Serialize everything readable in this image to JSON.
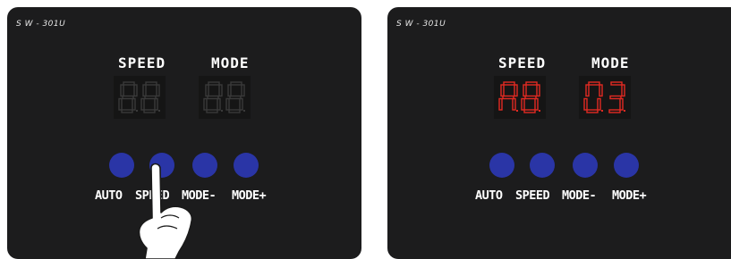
{
  "panel_left": {
    "model": "S W - 301U",
    "speed_label": "SPEED",
    "mode_label": "MODE",
    "speed_display": "88",
    "mode_display": "88",
    "display_color": "#3a3a3a",
    "buttons": [
      "AUTO",
      "SPEED",
      "MODE-",
      "MODE+"
    ],
    "pressed_button": "SPEED"
  },
  "panel_right": {
    "model": "S W - 301U",
    "speed_label": "SPEED",
    "mode_label": "MODE",
    "speed_display": "A8",
    "mode_display": "03",
    "display_color": "#e12a22",
    "buttons": [
      "AUTO",
      "SPEED",
      "MODE-",
      "MODE+"
    ]
  },
  "colors": {
    "panel_bg": "#1c1c1d",
    "button": "#2a35a6",
    "text": "#ffffff"
  },
  "icons": {
    "pointer": "pointing-hand-icon"
  }
}
